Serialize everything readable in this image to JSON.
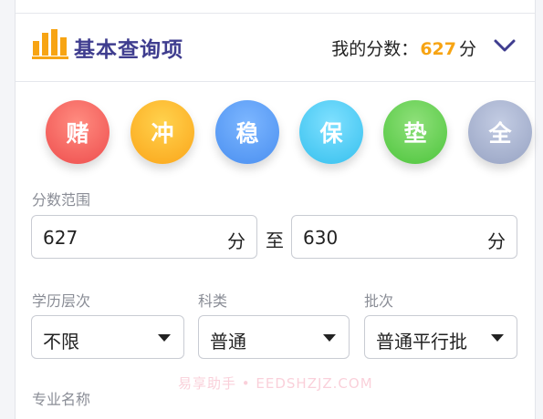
{
  "header": {
    "title": "基本查询项",
    "score_label": "我的分数：",
    "score_value": "627",
    "score_unit": "分"
  },
  "strategies": [
    "赌",
    "冲",
    "稳",
    "保",
    "垫",
    "全"
  ],
  "score_range": {
    "label": "分数范围",
    "min_value": "627",
    "max_value": "630",
    "unit": "分",
    "separator": "至"
  },
  "filters": {
    "education": {
      "label": "学历层次",
      "selected": "不限"
    },
    "subject": {
      "label": "科类",
      "selected": "普通"
    },
    "batch": {
      "label": "批次",
      "selected": "普通平行批"
    }
  },
  "major": {
    "label": "专业名称"
  },
  "watermark": "易享助手 • EEDSHZJZ.COM",
  "colors": {
    "title": "#3f3d8f",
    "score_accent": "#f7a413",
    "strategy_colors": [
      "#ee4d4d",
      "#fba51a",
      "#4a8ff0",
      "#36c0ee",
      "#4dc53c",
      "#97a3c3"
    ]
  },
  "icons": {
    "header_icon": "bar-chart-icon",
    "collapse_icon": "chevron-down-icon",
    "dropdown_icon": "caret-down-icon"
  }
}
